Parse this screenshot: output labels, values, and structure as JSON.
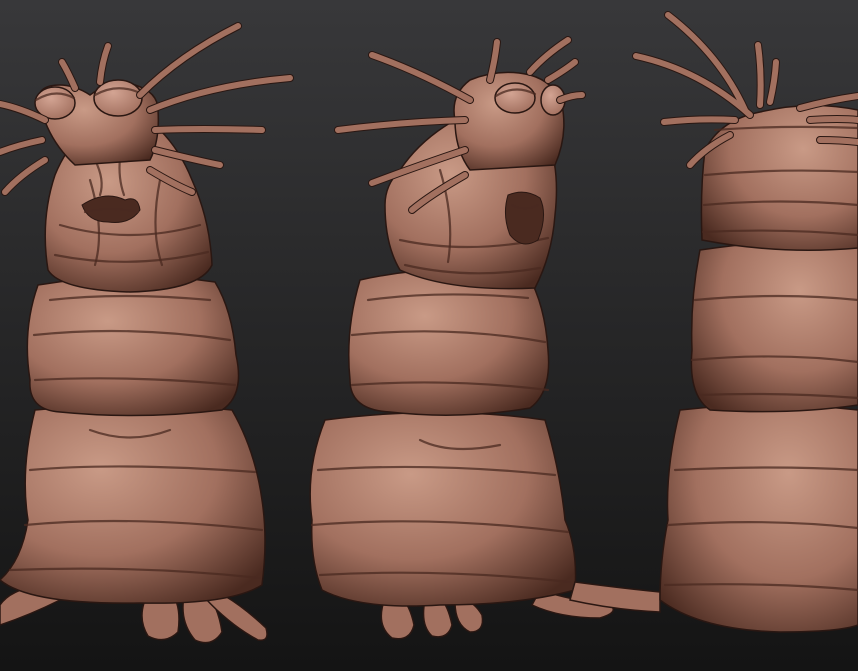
{
  "scene": {
    "background": {
      "top": "#38383a",
      "bottom": "#141414"
    },
    "material": {
      "base": "#a2705f",
      "highlight": "#c99a86",
      "shadow": "#4a2a20",
      "deep_shadow": "#2a1712",
      "eye_white": "#d3a493"
    },
    "views": [
      {
        "name": "front-view",
        "pose": "front"
      },
      {
        "name": "three-quarter-view",
        "pose": "three-quarter"
      },
      {
        "name": "back-view",
        "pose": "back"
      }
    ]
  }
}
